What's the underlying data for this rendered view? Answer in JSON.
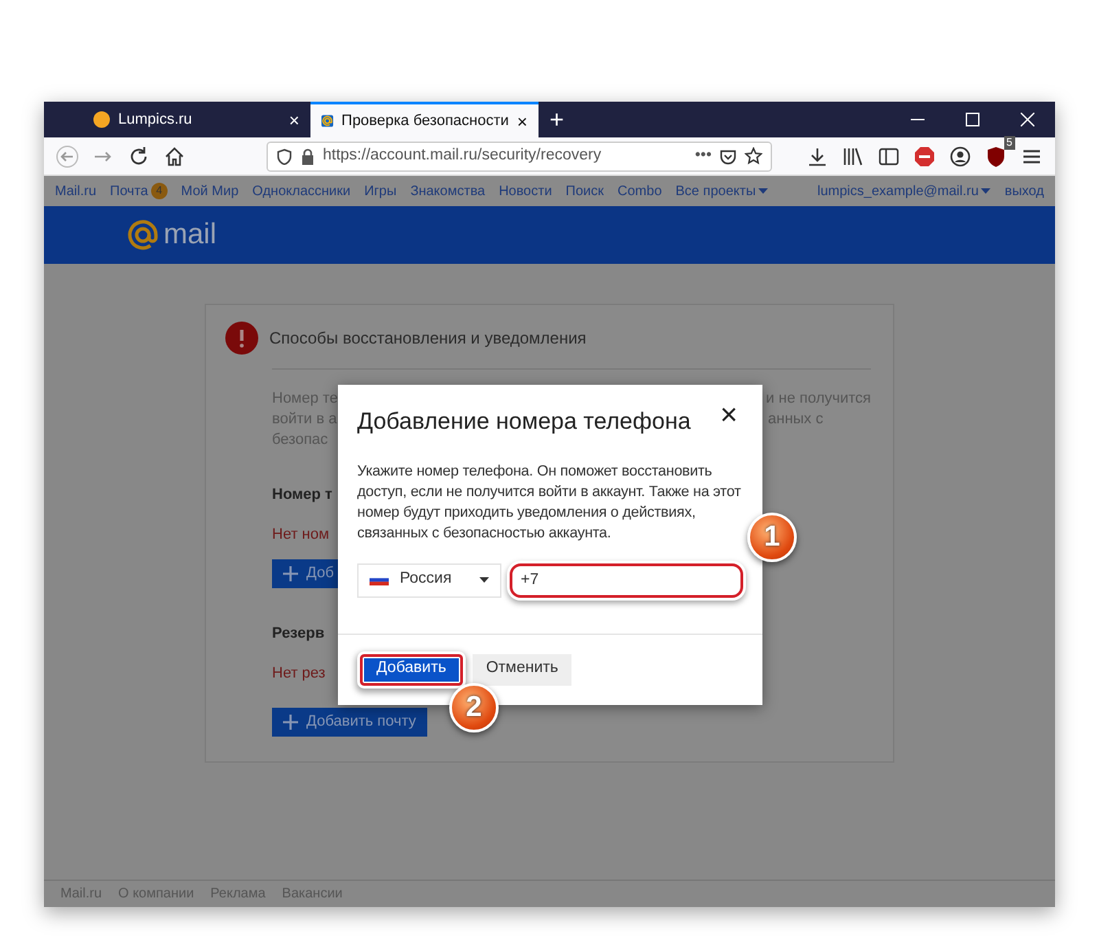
{
  "browser": {
    "tabs": [
      {
        "title": "Lumpics.ru",
        "selected": false,
        "close": "×"
      },
      {
        "title": "Проверка безопасности",
        "selected": true,
        "close": "×"
      }
    ],
    "new_tab": "+",
    "url": "https://account.mail.ru/security/recovery",
    "more": "•••",
    "extension_badge": "5"
  },
  "portal_bar": {
    "links": [
      {
        "label": "Mail.ru"
      },
      {
        "label": "Почта",
        "badge": "4"
      },
      {
        "label": "Мой Мир"
      },
      {
        "label": "Одноклассники"
      },
      {
        "label": "Игры"
      },
      {
        "label": "Знакомства"
      },
      {
        "label": "Новости"
      },
      {
        "label": "Поиск"
      },
      {
        "label": "Combo"
      },
      {
        "label": "Все проекты",
        "dropdown": true
      }
    ],
    "account": "lumpics_example@mail.ru",
    "logout": "выход"
  },
  "header": {
    "logo": "mail"
  },
  "card": {
    "title": "Способы восстановления и уведомления",
    "description_lines": [
      {
        "left": "Номер те",
        "right": "и не получится"
      },
      {
        "left": "войти в а",
        "right": "анных с"
      },
      {
        "left": "безопас"
      }
    ],
    "phone_heading": "Номер т",
    "phone_status": "Нет ном",
    "phone_button": "Доб",
    "backup_heading": "Резерв",
    "backup_status": "Нет рез",
    "backup_button": "Добавить почту"
  },
  "modal": {
    "title": "Добавление номера телефона",
    "close": "×",
    "text": "Укажите номер телефона. Он поможет восстановить доступ, если не получится войти в аккаунт. Также на этот номер будут приходить уведомления о действиях, связанных с безопасностью аккаунта.",
    "country": "Россия",
    "phone": "+7",
    "phone_highlighted": true,
    "buttons": [
      {
        "label": "Добавить",
        "kind": "primary",
        "highlighted": true
      },
      {
        "label": "Отменить",
        "kind": "secondary",
        "highlighted": false
      }
    ]
  },
  "annotations": [
    {
      "label": "1"
    },
    {
      "label": "2"
    }
  ],
  "footer": {
    "links": [
      "Mail.ru",
      "О компании",
      "Реклама",
      "Вакансии"
    ]
  }
}
